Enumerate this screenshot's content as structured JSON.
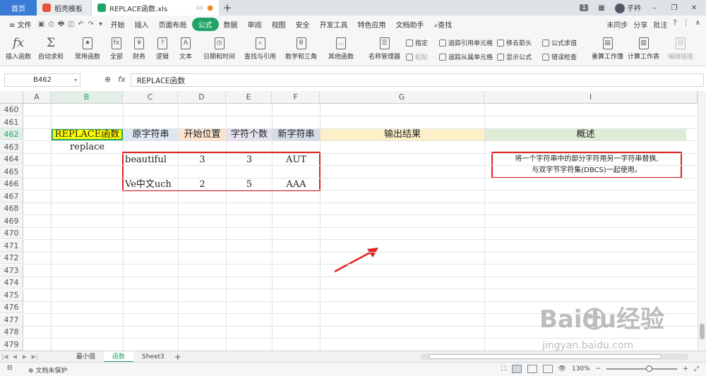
{
  "titlebar": {
    "tabs": [
      {
        "label": "首页"
      },
      {
        "label": "稻壳模板"
      },
      {
        "label": "REPLACE函数.xls"
      }
    ],
    "page_badge": "1",
    "user": "子衿"
  },
  "menubar": {
    "file_label": "≡ 文件",
    "items": [
      "开始",
      "插入",
      "页面布局",
      "公式",
      "数据",
      "审阅",
      "视图",
      "安全",
      "开发工具",
      "特色应用",
      "文档助手"
    ],
    "active_index": 3,
    "search_label": "查找",
    "right_items": [
      "未同步",
      "分享",
      "批注"
    ]
  },
  "ribbon": {
    "big_buttons": [
      "插入函数",
      "自动求和",
      "常用函数",
      "全部",
      "财务",
      "逻辑",
      "文本",
      "日期和时间",
      "查找与引用",
      "数学和三角",
      "其他函数",
      "名称管理器",
      "重算工作簿",
      "计算工作表",
      "编辑链接"
    ],
    "small_buttons": [
      "指定",
      "粘贴",
      "追踪引用单元格",
      "追踪从属单元格",
      "移去箭头",
      "显示公式",
      "公式求值",
      "错误检查"
    ]
  },
  "formula_bar": {
    "name_box": "B462",
    "fx": "fx",
    "content": "REPLACE函数"
  },
  "grid": {
    "columns": [
      "A",
      "B",
      "C",
      "D",
      "E",
      "F",
      "G",
      "I"
    ],
    "rows": [
      "460",
      "461",
      "462",
      "463",
      "464",
      "465",
      "466",
      "467",
      "468",
      "469",
      "470",
      "471",
      "472",
      "473",
      "474",
      "475",
      "476",
      "477",
      "478",
      "479"
    ],
    "header_row": {
      "B": "REPLACE函数",
      "C": "原字符串",
      "D": "开始位置",
      "E": "字符个数",
      "F": "新字符串",
      "G": "输出结果",
      "I": "概述"
    },
    "b463": "replace",
    "data_rows": [
      {
        "row": "464",
        "C": "beautiful",
        "D": "3",
        "E": "3",
        "F": "AUT"
      },
      {
        "row": "466",
        "C": "Ve中文uch",
        "D": "2",
        "E": "5",
        "F": "AAA"
      }
    ],
    "description_lines": [
      "将一个字符串中的部分字符用另一字符串替换,",
      "与双字节字符集(DBCS)一起使用。"
    ],
    "colors": {
      "b_header": "#ffff00",
      "c_header": "#dde7f3",
      "d_header": "#fbe3cf",
      "e_header": "#e6e1ee",
      "f_header": "#d4dbe7",
      "g_header": "#fdf0c8",
      "i_header": "#dcecd6",
      "highlight_red": "#e02020"
    }
  },
  "sheet_tabs": [
    "最小值",
    "函数",
    "Sheet3"
  ],
  "active_sheet_index": 1,
  "statusbar": {
    "protect_label": "文档未保护",
    "zoom": "130%"
  },
  "watermark": {
    "brand": "Baidu经验",
    "url": "jingyan.baidu.com"
  }
}
